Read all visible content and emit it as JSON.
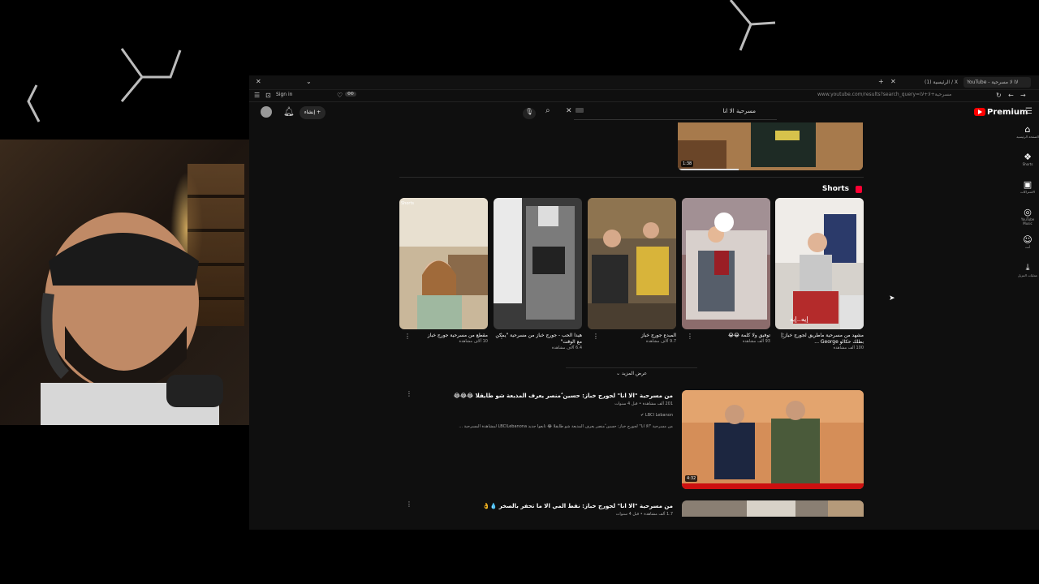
{
  "browser": {
    "tabs": [
      {
        "label": "YouTube - لاا لا مسرحية"
      },
      {
        "label": "(1) الرئيسية / X"
      }
    ],
    "url": "www.youtube.com/results?search_query=مسرحية+لا+لاا",
    "sign_in": "Sign in",
    "zoom_badge": "ΦΦ"
  },
  "youtube": {
    "search_query": "مسرحية الا انا",
    "create_label": "إنشاء",
    "premium_label": "Premium",
    "sidebar": [
      {
        "icon": "home-icon",
        "label": "الصفحة الرئيسية"
      },
      {
        "icon": "shorts-icon",
        "label": "Shorts"
      },
      {
        "icon": "subscriptions-icon",
        "label": "الاشتراكات"
      },
      {
        "icon": "music-icon",
        "label": "YouTube Music"
      },
      {
        "icon": "you-icon",
        "label": "أنت"
      },
      {
        "icon": "download-icon",
        "label": "عمليات التنزيل"
      }
    ],
    "top_video_duration": "1:38",
    "shorts_heading": "Shorts",
    "shorts": [
      {
        "title": "مشهد من مسرحية ماطريق لجورج خباز | بطلك حكالو George ...",
        "views": "100 ألف مشاهدة",
        "overlay": "إيه..إيه"
      },
      {
        "title": "توفيق ولا كلمة 😂😂",
        "views": "93 ألف مشاهدة",
        "overlay": ""
      },
      {
        "title": "المبدع جورج خباز",
        "views": "9.7 آلاف مشاهدة",
        "overlay": ""
      },
      {
        "title": "هيدا الحب - جورج خباز من مسرحية \"يمكن مع الوقت\"",
        "views": "6.4 آلاف مشاهدة",
        "overlay": ""
      },
      {
        "title": "مقطع من مسرحية جورج خباز",
        "views": "10 آلاف مشاهدة",
        "overlay": "Shorts"
      }
    ],
    "more_label": "عرض المزيد",
    "videos": [
      {
        "title": "من مسرحية \"الا انا\" لجورج خباز: حسين ُمنصر يعرف المذيعة شو طايقلا 😂😂😂",
        "meta": "201 ألف مشاهدة • قبل 4 سنوات",
        "channel": "LBCI Lebanon",
        "desc": "من مسرحية \"الا انا\" لجورج خباز: حسين ُمنصر يعرف المذيعة شو طايقلا 😂 تابعوا جديد LBCILebanona لمشاهدة المسرحية ...",
        "duration": "4:32"
      },
      {
        "title": "من مسرحية \"الا انا\" لجورج خباز: نقط المي الا ما تحفر بالصخر 💧👌",
        "meta": "1.7 ألف مشاهدة • قبل 4 سنوات",
        "channel": "",
        "desc": "",
        "duration": ""
      }
    ]
  }
}
